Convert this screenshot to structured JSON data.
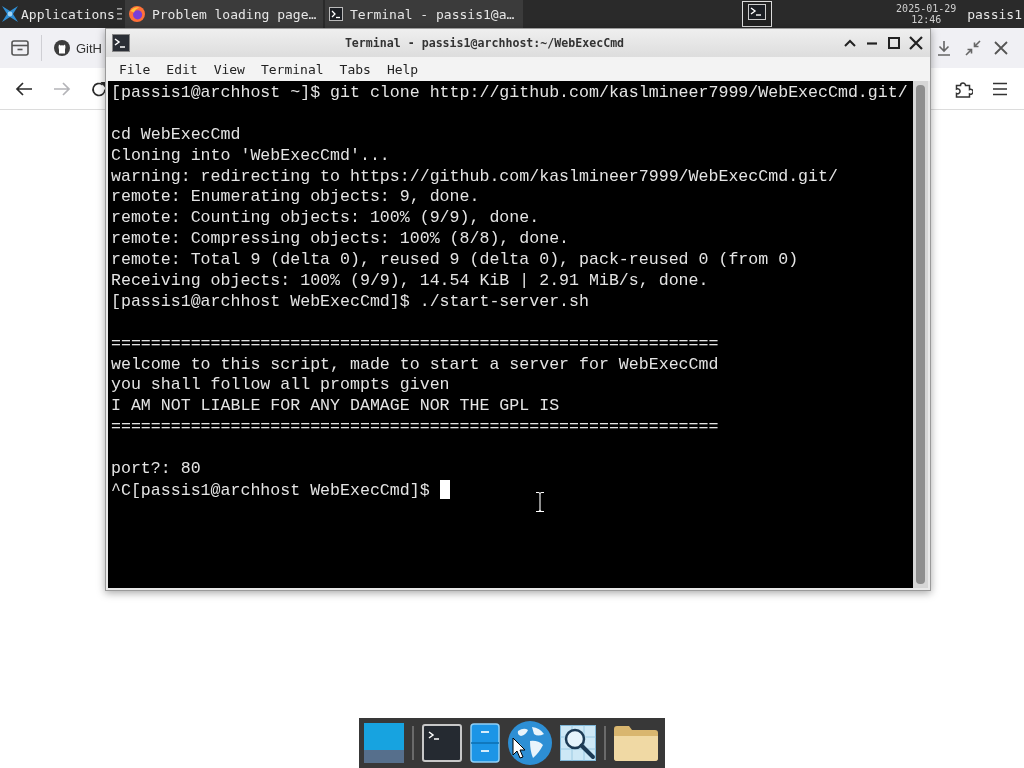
{
  "top_panel": {
    "menu_label": "Applications",
    "tasks": [
      {
        "kind": "browser",
        "title": "Problem loading page…"
      },
      {
        "kind": "terminal",
        "title": "Terminal - passis1@a…"
      }
    ],
    "clock": {
      "date": "2025-01-29",
      "time": "12:46"
    },
    "user": "passis1"
  },
  "browser": {
    "tab": {
      "label": "GitH"
    },
    "nav": [
      {
        "kind": "back",
        "disabled": false
      },
      {
        "kind": "forward",
        "disabled": true
      },
      {
        "kind": "reload",
        "disabled": false
      }
    ]
  },
  "terminal_window": {
    "title": "Terminal - passis1@archhost:~/WebExecCmd",
    "menu": [
      "File",
      "Edit",
      "View",
      "Terminal",
      "Tabs",
      "Help"
    ],
    "blocks": [
      [
        "[passis1@archhost ~]$ git clone http://github.com/kaslmineer7999/WebExecCmd.git/"
      ],
      [
        "cd WebExecCmd",
        "Cloning into 'WebExecCmd'...",
        "warning: redirecting to https://github.com/kaslmineer7999/WebExecCmd.git/",
        "remote: Enumerating objects: 9, done.",
        "remote: Counting objects: 100% (9/9), done.",
        "remote: Compressing objects: 100% (8/8), done.",
        "remote: Total 9 (delta 0), reused 9 (delta 0), pack-reused 0 (from 0)",
        "Receiving objects: 100% (9/9), 14.54 KiB | 2.91 MiB/s, done.",
        "[passis1@archhost WebExecCmd]$ ./start-server.sh"
      ],
      [
        "=============================================================",
        "welcome to this script, made to start a server for WebExecCmd",
        "you shall follow all prompts given",
        "I AM NOT LIABLE FOR ANY DAMAGE NOR THE GPL IS",
        "============================================================="
      ],
      [
        "port?: 80",
        "^C[passis1@archhost WebExecCmd]$"
      ]
    ],
    "cursor": true
  },
  "dock": {
    "items": [
      {
        "kind": "desktop"
      },
      {
        "kind": "separator"
      },
      {
        "kind": "terminal"
      },
      {
        "kind": "cabinet"
      },
      {
        "kind": "globe"
      },
      {
        "kind": "finder"
      },
      {
        "kind": "separator"
      },
      {
        "kind": "folder"
      }
    ]
  }
}
